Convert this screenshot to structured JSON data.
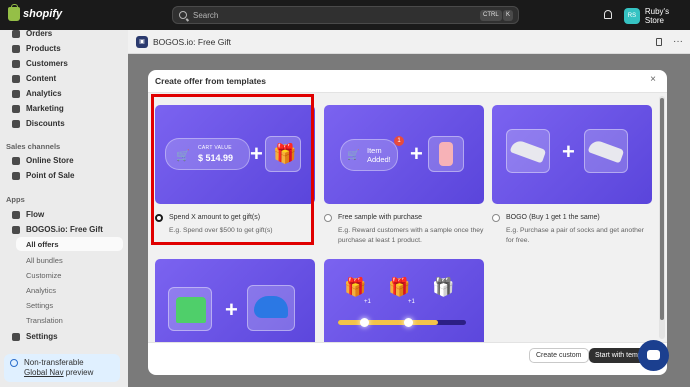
{
  "topbar": {
    "brand": "shopify",
    "search_placeholder": "Search",
    "shortcut_ctrl": "CTRL",
    "shortcut_key": "K",
    "store_initials": "RS",
    "store_name": "Ruby's Store"
  },
  "sidebar": {
    "items": [
      {
        "label": "Orders",
        "icon": "orders-icon"
      },
      {
        "label": "Products",
        "icon": "products-icon"
      },
      {
        "label": "Customers",
        "icon": "customers-icon"
      },
      {
        "label": "Content",
        "icon": "content-icon"
      },
      {
        "label": "Analytics",
        "icon": "analytics-icon"
      },
      {
        "label": "Marketing",
        "icon": "marketing-icon"
      },
      {
        "label": "Discounts",
        "icon": "discounts-icon"
      }
    ],
    "sales_channels_label": "Sales channels",
    "sales_channels": [
      {
        "label": "Online Store",
        "icon": "online-store-icon"
      },
      {
        "label": "Point of Sale",
        "icon": "point-of-sale-icon"
      }
    ],
    "apps_label": "Apps",
    "apps": [
      {
        "label": "Flow",
        "icon": "flow-icon"
      },
      {
        "label": "BOGOS.io: Free Gift",
        "icon": "bogos-icon"
      }
    ],
    "app_subitems": [
      "All offers",
      "All bundles",
      "Customize",
      "Analytics",
      "Settings",
      "Translation"
    ],
    "settings_label": "Settings",
    "notice_line1": "Non-transferable",
    "notice_link": "Global Nav",
    "notice_line2": " preview"
  },
  "app_header": {
    "title": "BOGOS.io: Free Gift",
    "more": "···"
  },
  "modal": {
    "title": "Create offer from templates",
    "close": "×",
    "templates": [
      {
        "title": "Spend X amount to get gift(s)",
        "description": "E.g. Spend over $500 to get gift(s)",
        "selected": true,
        "cart_label": "CART VALUE",
        "cart_value": "$ 514.99"
      },
      {
        "title": "Free sample with purchase",
        "description": "E.g. Reward customers with a sample once they purchase at least 1 product.",
        "selected": false,
        "item_label": "Item Added!",
        "badge": "1"
      },
      {
        "title": "BOGO (Buy 1 get 1 the same)",
        "description": "E.g. Purchase a pair of socks and get another for free.",
        "selected": false
      }
    ],
    "plus": "+",
    "progress_labels": [
      "+1",
      "+1"
    ],
    "buttons": {
      "secondary": "Create custom",
      "primary": "Start with temp"
    }
  },
  "colors": {
    "tile_gradient_start": "#7b63f0",
    "tile_gradient_end": "#5a45db",
    "highlight": "#e00000",
    "chat": "#1b3f8f"
  }
}
